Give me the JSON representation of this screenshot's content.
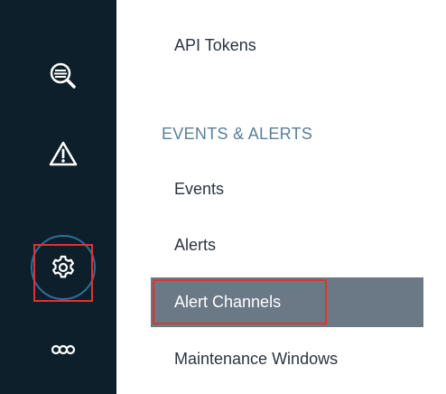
{
  "rail": {
    "items": [
      {
        "name": "search-icon",
        "active": false
      },
      {
        "name": "warning-icon",
        "active": false
      },
      {
        "name": "gear-icon",
        "active": true
      },
      {
        "name": "infinity-icon",
        "active": false
      }
    ]
  },
  "menu": {
    "api_tokens": "API Tokens",
    "section_events_alerts": "EVENTS & ALERTS",
    "events": "Events",
    "alerts": "Alerts",
    "alert_channels": "Alert Channels",
    "maintenance_windows": "Maintenance Windows"
  },
  "colors": {
    "rail_bg": "#0d1f2a",
    "selected_bg": "#6b7886",
    "highlight": "#e0332b",
    "section_header": "#5a7f96",
    "text": "#2b3340"
  }
}
